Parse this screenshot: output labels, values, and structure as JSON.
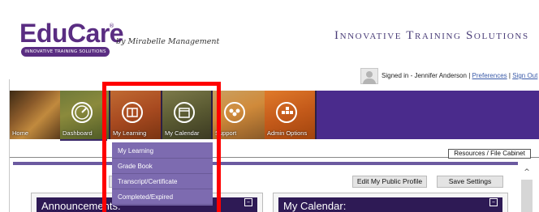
{
  "brand": {
    "logo_text": "EduCare",
    "logo_reg": "®",
    "logo_subtitle": "INNOVATIVE TRAINING SOLUTIONS",
    "by_line": "by Mirabelle Management",
    "tagline": "Innovative Training Solutions",
    "primary_color": "#5a2d82"
  },
  "user_bar": {
    "avatar_icon": "user-avatar-icon",
    "signed_in_text": "Signed in - Jennifer Anderson",
    "separator": "|",
    "preferences_link": "Preferences",
    "sign_out_link": "Sign Out"
  },
  "nav": {
    "items": [
      {
        "label": "Home",
        "icon": "home-photo-icon"
      },
      {
        "label": "Dashboard",
        "icon": "dashboard-gauge-icon"
      },
      {
        "label": "My Learning",
        "icon": "learning-book-icon"
      },
      {
        "label": "My Calendar",
        "icon": "calendar-icon"
      },
      {
        "label": "Support",
        "icon": "support-people-icon"
      },
      {
        "label": "Admin Options",
        "icon": "admin-grid-icon"
      }
    ],
    "active_index": 2,
    "accent_color": "#4a2b8c"
  },
  "dropdown": {
    "items": [
      "My Learning",
      "Grade Book",
      "Transcript/Certificate",
      "Completed/Expired"
    ],
    "background": "#7a68ad"
  },
  "toolbar": {
    "resources_label": "Resources / File Cabinet",
    "edit_profile_label": "Edit My Public Profile",
    "save_settings_label": "Save Settings"
  },
  "panels": {
    "announcements_title": "Announcements:",
    "calendar_title": "My Calendar:",
    "minimize_glyph": "–"
  },
  "scroll": {
    "up_glyph": "^"
  },
  "highlight_color": "#ff0000"
}
